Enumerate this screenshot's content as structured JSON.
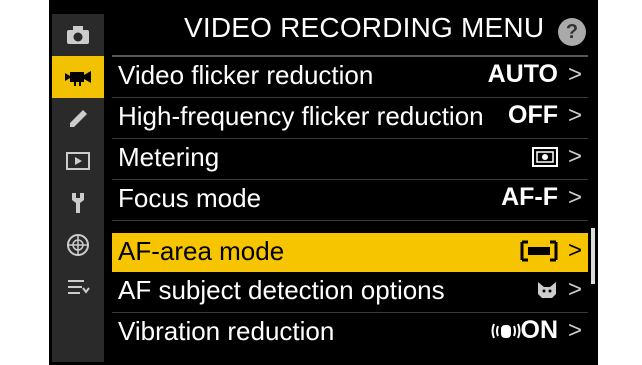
{
  "menu": {
    "title": "VIDEO RECORDING MENU",
    "help": "?"
  },
  "sidebar": {
    "items": [
      {
        "icon": "camera-icon",
        "active": false
      },
      {
        "icon": "video-camera-icon",
        "active": true
      },
      {
        "icon": "pencil-icon",
        "active": false
      },
      {
        "icon": "playback-icon",
        "active": false
      },
      {
        "icon": "wrench-icon",
        "active": false
      },
      {
        "icon": "network-icon",
        "active": false
      },
      {
        "icon": "my-menu-icon",
        "active": false
      }
    ]
  },
  "rows": [
    {
      "label": "Video flicker reduction",
      "value": "AUTO",
      "chevron": ">"
    },
    {
      "label": "High-frequency flicker reduction",
      "value": "OFF",
      "chevron": ">"
    },
    {
      "label": "Metering",
      "value_icon": "matrix-metering-icon",
      "chevron": ">"
    },
    {
      "label": "Focus mode",
      "value": "AF-F",
      "chevron": ">"
    },
    {
      "label": "AF-area mode",
      "value_icon": "wide-area-af-icon",
      "chevron": ">",
      "selected": true
    },
    {
      "label": "AF subject detection options",
      "value_icon": "animal-detection-icon",
      "chevron": ">"
    },
    {
      "label": "Vibration reduction",
      "value": "ON",
      "value_icon": "vr-hand-icon",
      "chevron": ">"
    }
  ],
  "colors": {
    "highlight": "#f7c500",
    "background": "#000000",
    "sidebar": "#2a2a2a"
  }
}
